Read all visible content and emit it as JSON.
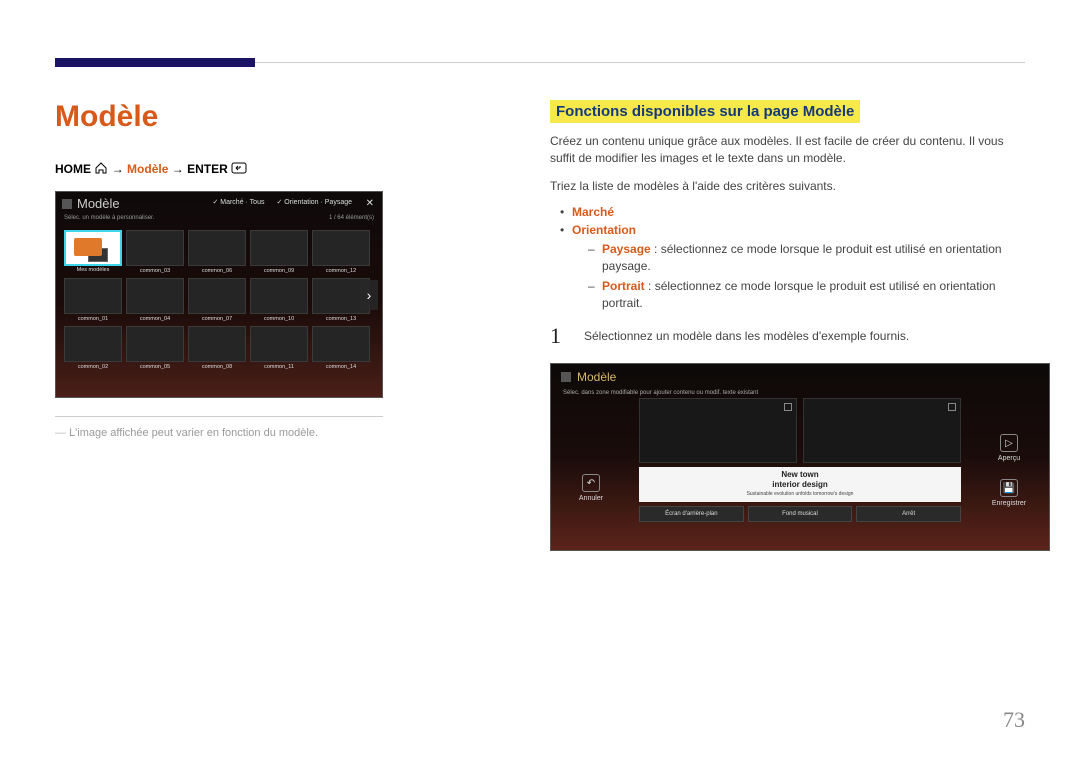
{
  "page": {
    "number": "73",
    "title": "Modèle",
    "breadcrumb": {
      "home": "HOME",
      "modele": "Modèle",
      "enter": "ENTER",
      "arrow": "→"
    },
    "note": "L'image affichée peut varier en fonction du modèle."
  },
  "screenshot1": {
    "title": "Modèle",
    "subtitle_left": "Sélec. un modèle à personnaliser.",
    "filter_marche": "Marché · Tous",
    "filter_orientation": "Orientation · Paysage",
    "close": "✕",
    "counter": "1 / 64 élément(s)",
    "first_label": "Mes modèles",
    "row1": [
      "common_03",
      "common_06",
      "common_09",
      "common_12"
    ],
    "row2": [
      "common_01",
      "common_04",
      "common_07",
      "common_10",
      "common_13"
    ],
    "row3": [
      "common_02",
      "common_05",
      "common_08",
      "common_11",
      "common_14"
    ],
    "arrow": "›"
  },
  "section": {
    "heading": "Fonctions disponibles sur la page Modèle",
    "p1": "Créez un contenu unique grâce aux modèles. Il est facile de créer du contenu. Il vous suffit de modifier les images et le texte dans un modèle.",
    "p2": "Triez la liste de modèles à l'aide des critères suivants.",
    "bullets": {
      "marche": "Marché",
      "orientation": "Orientation",
      "paysage_label": "Paysage",
      "paysage_text": " : sélectionnez ce mode lorsque le produit est utilisé en orientation paysage.",
      "portrait_label": "Portrait",
      "portrait_text": " : sélectionnez ce mode lorsque le produit est utilisé en orientation portrait."
    },
    "step1_num": "1",
    "step1_text": "Sélectionnez un modèle dans les modèles d'exemple fournis."
  },
  "screenshot2": {
    "title": "Modèle",
    "subtitle": "Sélec. dans zone modifiable pour ajouter contenu ou modif. texte existant",
    "text1": "New town",
    "text2": "interior design",
    "text3": "Sustainable evolution unfolds tomorrow's design",
    "tab1": "Écran d'arrière-plan",
    "tab2": "Fond musical",
    "tab3": "Arrêt",
    "left_btn": "Annuler",
    "right_btn1": "Aperçu",
    "right_btn2": "Enregistrer"
  }
}
